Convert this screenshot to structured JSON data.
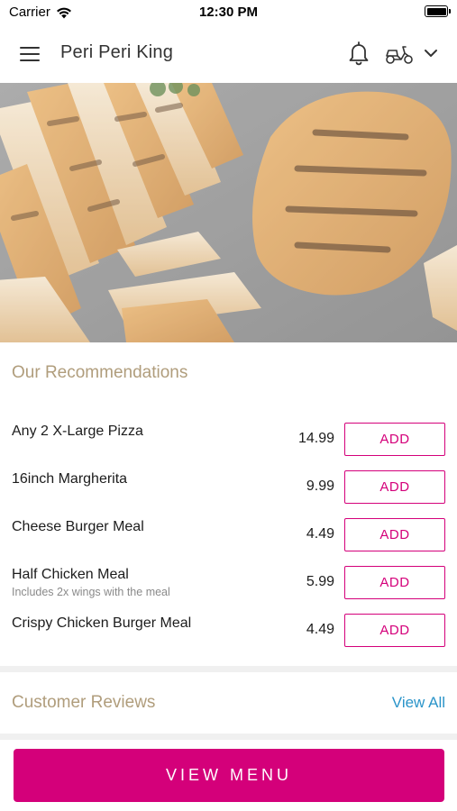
{
  "status_bar": {
    "carrier": "Carrier",
    "time": "12:30 PM"
  },
  "header": {
    "title": "Peri Peri King"
  },
  "hero": {
    "image": "grilled peri peri chicken"
  },
  "recommendations": {
    "title": "Our Recommendations",
    "items": [
      {
        "name": "Any 2 X-Large Pizza",
        "description": "",
        "price": "14.99",
        "add_label": "ADD"
      },
      {
        "name": "16inch Margherita",
        "description": "",
        "price": "9.99",
        "add_label": "ADD"
      },
      {
        "name": "Cheese Burger Meal",
        "description": "",
        "price": "4.49",
        "add_label": "ADD"
      },
      {
        "name": "Half Chicken Meal",
        "description": "Includes 2x wings with the meal",
        "price": "5.99",
        "add_label": "ADD"
      },
      {
        "name": "Crispy Chicken Burger Meal",
        "description": "",
        "price": "4.49",
        "add_label": "ADD"
      }
    ]
  },
  "reviews": {
    "title": "Customer Reviews",
    "view_all": "View All"
  },
  "footer": {
    "view_menu_label": "VIEW MENU"
  },
  "colors": {
    "accent": "#d4007a",
    "section_title": "#b09d7c",
    "link": "#2a94c9"
  },
  "icons": [
    "menu-icon",
    "bell-icon",
    "scooter-icon",
    "chevron-down-icon",
    "wifi-icon",
    "battery-icon"
  ]
}
